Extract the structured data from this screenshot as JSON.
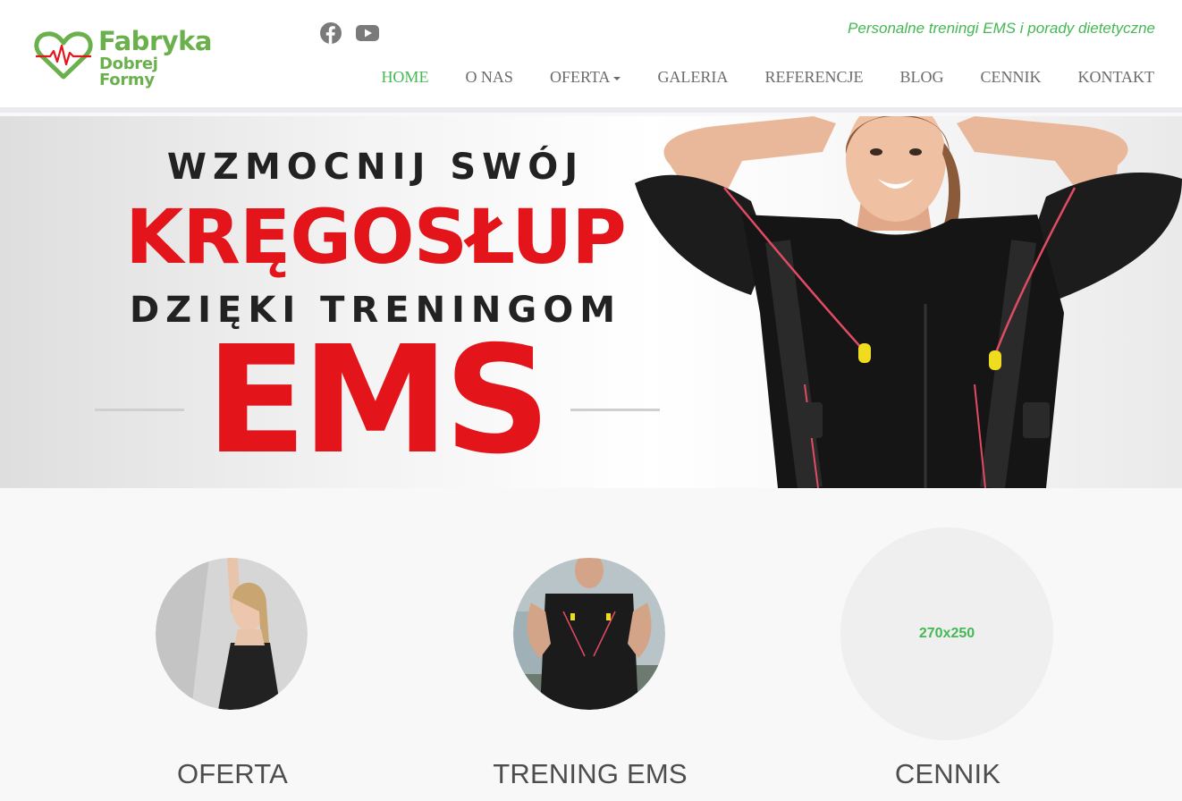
{
  "brand": {
    "name_line1": "Fabryka",
    "name_line2": "Dobrej Formy",
    "color": "#6ab04c",
    "heart_color": "#6ab04c",
    "pulse_color": "#e3151b"
  },
  "social": [
    {
      "icon": "facebook-icon"
    },
    {
      "icon": "youtube-icon"
    }
  ],
  "tagline": "Personalne treningi EMS i porady dietetyczne",
  "nav": {
    "items": [
      {
        "label": "HOME",
        "active": true
      },
      {
        "label": "O NAS"
      },
      {
        "label": "OFERTA",
        "dropdown": true
      },
      {
        "label": "GALERIA"
      },
      {
        "label": "REFERENCJE"
      },
      {
        "label": "BLOG"
      },
      {
        "label": "CENNIK"
      },
      {
        "label": "KONTAKT"
      }
    ],
    "active_color": "#45b854",
    "text_color": "#6b6b6b"
  },
  "hero": {
    "line1": "WZMOCNIJ SWÓJ",
    "line2": "KRĘGOSŁUP",
    "line3": "DZIĘKI TRENINGOM",
    "line4": "EMS",
    "accent_color": "#e3151b"
  },
  "cards": [
    {
      "title": "OFERTA",
      "image": "woman-athlete-photo"
    },
    {
      "title": "TRENING EMS",
      "image": "man-ems-suit-photo"
    },
    {
      "title": "CENNIK",
      "placeholder_text": "270x250"
    }
  ]
}
